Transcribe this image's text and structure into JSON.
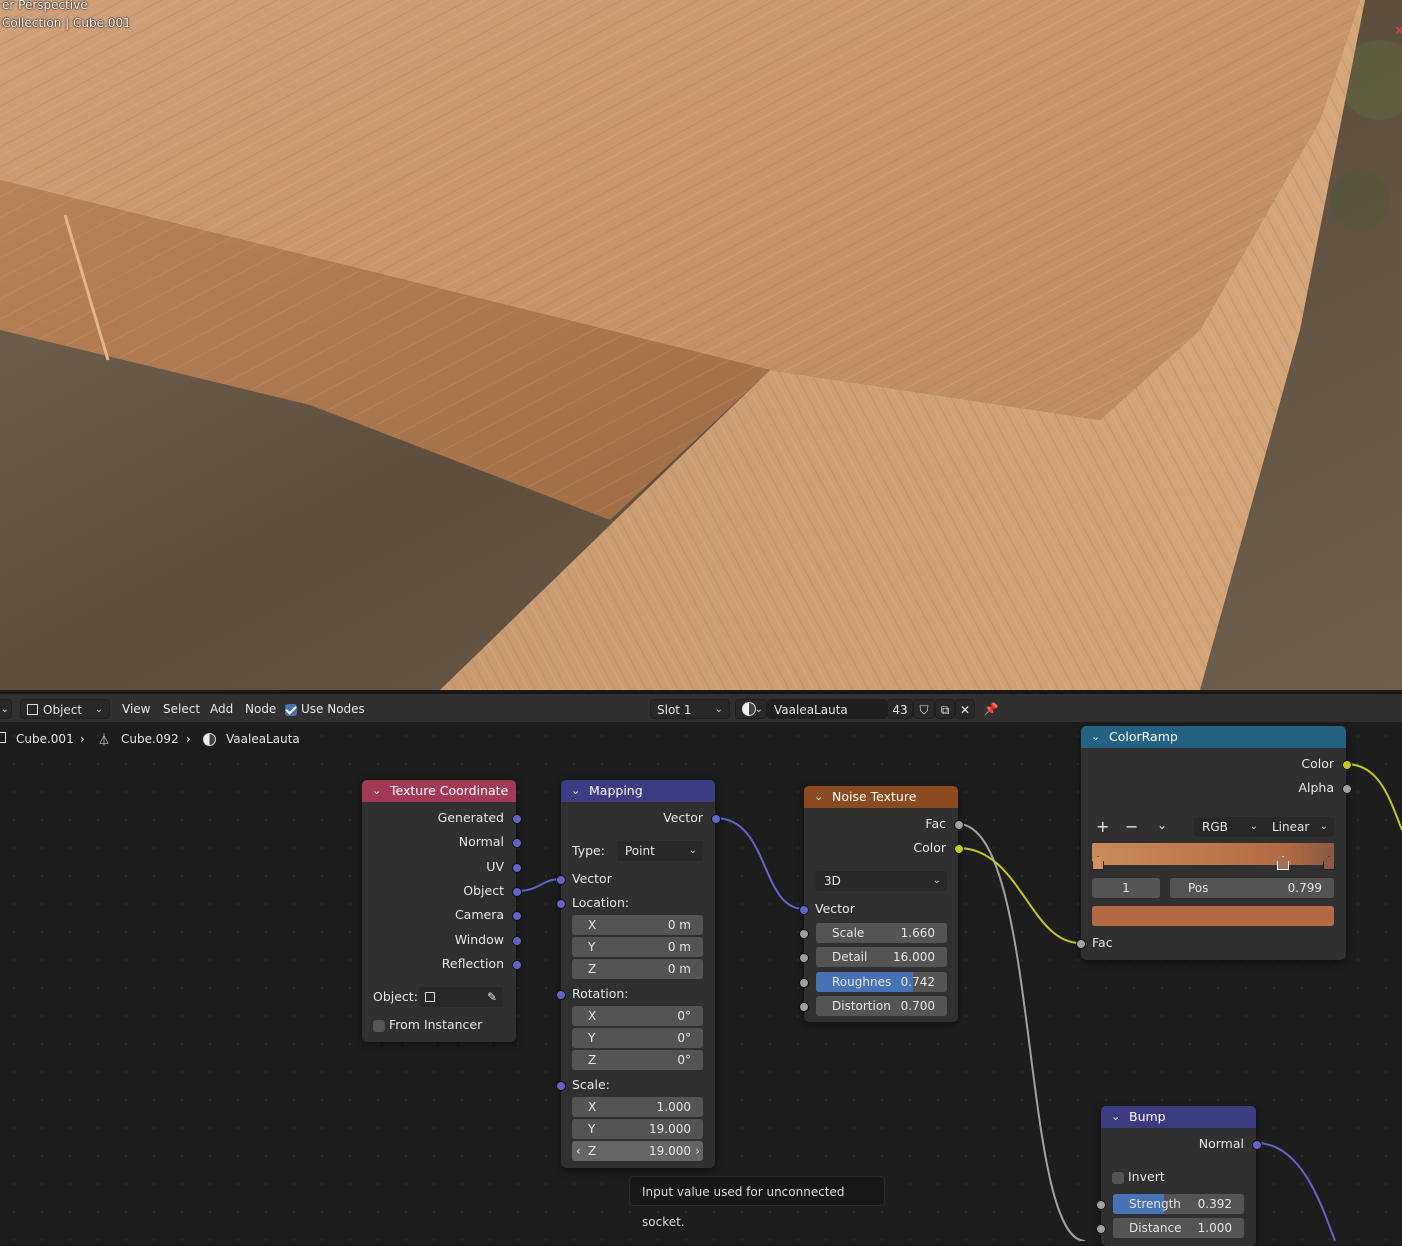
{
  "viewport": {
    "view_label": "er Perspective",
    "collection_label": "Collection | Cube.001",
    "close_icon": "x-icon"
  },
  "header": {
    "mode_label": "Object",
    "menus": [
      "View",
      "Select",
      "Add",
      "Node"
    ],
    "use_nodes_label": "Use Nodes",
    "use_nodes_checked": true,
    "slot_label": "Slot 1",
    "material_name": "VaaleaLauta",
    "user_count": "43"
  },
  "breadcrumb": {
    "object": "Cube.001",
    "mesh": "Cube.092",
    "material": "VaaleaLauta"
  },
  "nodes": {
    "texcoord": {
      "title": "Texture Coordinate",
      "color": "#a23a55",
      "outputs": [
        "Generated",
        "Normal",
        "UV",
        "Object",
        "Camera",
        "Window",
        "Reflection"
      ],
      "object_label": "Object:",
      "from_instancer_label": "From Instancer"
    },
    "mapping": {
      "title": "Mapping",
      "color": "#3c3c83",
      "output": "Vector",
      "type_label": "Type:",
      "type_value": "Point",
      "vector_label": "Vector",
      "location_label": "Location:",
      "location": [
        {
          "axis": "X",
          "value": "0 m"
        },
        {
          "axis": "Y",
          "value": "0 m"
        },
        {
          "axis": "Z",
          "value": "0 m"
        }
      ],
      "rotation_label": "Rotation:",
      "rotation": [
        {
          "axis": "X",
          "value": "0°"
        },
        {
          "axis": "Y",
          "value": "0°"
        },
        {
          "axis": "Z",
          "value": "0°"
        }
      ],
      "scale_label": "Scale:",
      "scale": [
        {
          "axis": "X",
          "value": "1.000"
        },
        {
          "axis": "Y",
          "value": "19.000"
        },
        {
          "axis": "Z",
          "value": "19.000"
        }
      ]
    },
    "noise": {
      "title": "Noise Texture",
      "color": "#8b4a1f",
      "outputs": [
        "Fac",
        "Color"
      ],
      "dimensions": "3D",
      "vector_label": "Vector",
      "fields": [
        {
          "label": "Scale",
          "value": "1.660"
        },
        {
          "label": "Detail",
          "value": "16.000"
        },
        {
          "label": "Roughnes",
          "value": "0.742",
          "fill": 0.742
        },
        {
          "label": "Distortion",
          "value": "0.700"
        }
      ]
    },
    "colorramp": {
      "title": "ColorRamp",
      "color": "#246283",
      "outputs": [
        "Color",
        "Alpha"
      ],
      "add_icon": "plus-icon",
      "remove_icon": "minus-icon",
      "mode": "RGB",
      "interpolation": "Linear",
      "stop_index": "1",
      "pos_label": "Pos",
      "pos_value": "0.799",
      "ramp_start": "#c98a5a",
      "ramp_end": "#8a5a44",
      "active_color": "#b36a44",
      "input_label": "Fac"
    },
    "bump": {
      "title": "Bump",
      "color": "#3c3c83",
      "output": "Normal",
      "invert_label": "Invert",
      "fields": [
        {
          "label": "Strength",
          "value": "0.392",
          "fill": 0.392
        },
        {
          "label": "Distance",
          "value": "1.000"
        }
      ]
    }
  },
  "tooltip": "Input value used for unconnected socket."
}
